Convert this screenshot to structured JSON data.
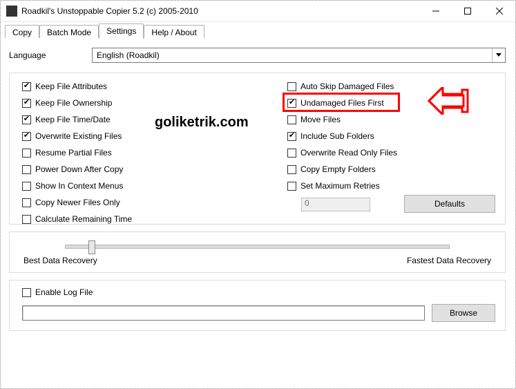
{
  "title": "Roadkil's Unstoppable Copier 5.2 (c) 2005-2010",
  "tabs": {
    "copy": "Copy",
    "batch": "Batch Mode",
    "settings": "Settings",
    "help": "Help / About"
  },
  "language": {
    "label": "Language",
    "value": "English (Roadkil)"
  },
  "options_left": [
    {
      "label": "Keep File Attributes",
      "checked": true
    },
    {
      "label": "Keep File Ownership",
      "checked": true
    },
    {
      "label": "Keep File Time/Date",
      "checked": true
    },
    {
      "label": "Overwrite Existing Files",
      "checked": true
    },
    {
      "label": "Resume Partial Files",
      "checked": false
    },
    {
      "label": "Power Down After Copy",
      "checked": false
    },
    {
      "label": "Show In Context Menus",
      "checked": false
    },
    {
      "label": "Copy Newer Files Only",
      "checked": false
    },
    {
      "label": "Calculate Remaining Time",
      "checked": false
    }
  ],
  "options_right": [
    {
      "label": "Auto Skip Damaged Files",
      "checked": false
    },
    {
      "label": "Undamaged Files First",
      "checked": true
    },
    {
      "label": "Move Files",
      "checked": false
    },
    {
      "label": "Include Sub Folders",
      "checked": true
    },
    {
      "label": "Overwrite Read Only Files",
      "checked": false
    },
    {
      "label": "Copy Empty Folders",
      "checked": false
    },
    {
      "label": "Set Maximum Retries",
      "checked": false
    }
  ],
  "retries_value": "0",
  "defaults_label": "Defaults",
  "slider": {
    "left_label": "Best Data Recovery",
    "right_label": "Fastest Data Recovery",
    "value_pct": 6
  },
  "log": {
    "enable_label": "Enable Log File",
    "enable_checked": false,
    "path": "",
    "browse_label": "Browse"
  },
  "watermark": "goliketrik.com"
}
